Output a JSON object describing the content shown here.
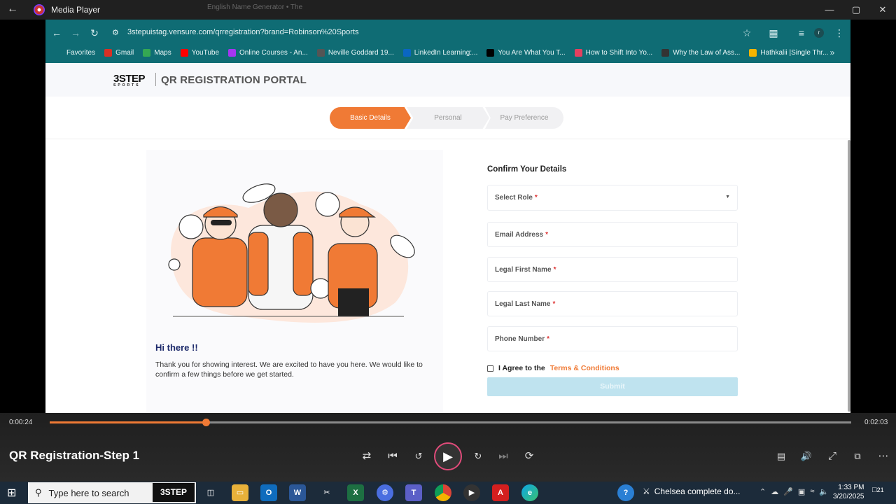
{
  "media_player": {
    "app_title": "Media Player",
    "current_time": "0:00:24",
    "total_time": "0:02:03",
    "progress": 0.195,
    "video_title": "QR Registration-Step 1"
  },
  "ghost_tabs": [
    "English Name Generator • The"
  ],
  "browser": {
    "url": "3stepuistag.vensure.com/qrregistration?brand=Robinson%20Sports",
    "profile_initial": "r",
    "bookmarks": [
      {
        "label": "Favorites",
        "color": "#0f6c74",
        "icon": "folder-icon"
      },
      {
        "label": "Gmail",
        "color": "#d93025",
        "icon": "gmail-icon"
      },
      {
        "label": "Maps",
        "color": "#34a853",
        "icon": "maps-icon"
      },
      {
        "label": "YouTube",
        "color": "#ff0000",
        "icon": "youtube-icon"
      },
      {
        "label": "Online Courses - An...",
        "color": "#a435f0",
        "icon": "udemy-icon"
      },
      {
        "label": "Neville Goddard 19...",
        "color": "#555555",
        "icon": "globe-icon"
      },
      {
        "label": "LinkedIn Learning:...",
        "color": "#0a66c2",
        "icon": "linkedin-icon"
      },
      {
        "label": "You Are What You T...",
        "color": "#000000",
        "icon": "medium-icon"
      },
      {
        "label": "How to Shift Into Yo...",
        "color": "#e4405f",
        "icon": "instagram-icon"
      },
      {
        "label": "Why the Law of Ass...",
        "color": "#333333",
        "icon": "bookmark-icon"
      },
      {
        "label": "Hathkalii |Single Thr...",
        "color": "#f4b400",
        "icon": "shop-icon"
      }
    ]
  },
  "page": {
    "brand_logo": "3STEP",
    "brand_logo_sub": "SPORTS",
    "portal_title": "QR REGISTRATION PORTAL",
    "steps": [
      "Basic Details",
      "Personal",
      "Pay Preference"
    ],
    "active_step": 0,
    "greeting_title": "Hi there !!",
    "greeting_text": "Thank you for showing interest. We are excited to have you here. We would like to confirm a few things before we get started.",
    "form_title": "Confirm Your Details",
    "fields": [
      {
        "label": "Select Role",
        "required": "*"
      },
      {
        "label": "Email Address",
        "required": "*"
      },
      {
        "label": "Legal First Name",
        "required": "*"
      },
      {
        "label": "Legal Last Name",
        "required": "*"
      },
      {
        "label": "Phone Number",
        "required": "*"
      }
    ],
    "agree_text": "I Agree to the",
    "terms_link": "Terms & Conditions",
    "submit_label": "Submit",
    "accent_color": "#f07a35"
  },
  "taskbar": {
    "search_placeholder": "Type here to search",
    "logo_text": "3STEP",
    "news_text": "Chelsea complete do...",
    "time": "1:33 PM",
    "date": "3/20/2025",
    "notifications": "21"
  }
}
